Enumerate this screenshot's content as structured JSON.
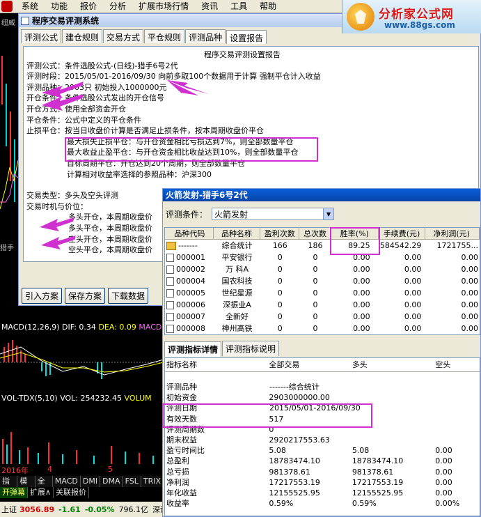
{
  "menubar": {
    "items": [
      "系统",
      "功能",
      "报价",
      "分析",
      "扩展市场行情",
      "资讯",
      "工具",
      "帮助"
    ]
  },
  "logo": {
    "brand": "分析家公式网",
    "url": "www.88gs.com"
  },
  "background": {
    "left_label": "纽威",
    "lower_label": "猎手",
    "macd": {
      "name": "MACD(12,26,9)",
      "dif": "DIF: 0.34",
      "dea": "DEA: 0.09",
      "extra": "MACD"
    },
    "vol": {
      "name": "VOL-TDX(5,10)",
      "vol": "VOL: 254232.45",
      "extra": "VOLUM"
    },
    "year": "2016年",
    "year_marks": [
      "4",
      "5"
    ],
    "tabs": [
      "指标",
      "模板",
      "全部",
      "MACD",
      "DMI",
      "DMA",
      "FSL",
      "TRIX"
    ],
    "tabs2": [
      "开弹幕",
      "扩展∧",
      "关联报价"
    ],
    "status": {
      "index": "上证",
      "value": "3056.89",
      "change": "-1.61",
      "pct": "-0.05%",
      "amount": "796.1亿",
      "more": "深证"
    }
  },
  "dialog": {
    "title": "程序交易评测系统",
    "tabs": [
      "评测公式",
      "建仓规则",
      "交易方式",
      "平仓规则",
      "评测品种",
      "设置报告"
    ],
    "active_tab": 5,
    "report": {
      "heading": "程序交易评测设置报告",
      "formula": "评测公式：条件选股公式-(日线)-猎手6号2代",
      "period": "评测时段：2015/05/01-2016/09/30  向前多取100个数据用于计算 强制平仓计入收益",
      "variety": "评测品种：2903只  初始投入1000000元",
      "open_cond": "开仓条件：条件选股公式发出的开仓信号",
      "open_method": "开仓方式：使用全部资金开仓",
      "close_cond": "平仓条件：公式中定义的平仓条件",
      "stop": "止损平仓：按当日收盘价计算是否满足止损条件，按本周期收盘价平仓",
      "max_loss": "最大损失止损平仓：与开仓资金相比亏损达到7%，则全部数量平仓",
      "max_gain": "最大收益止盈平仓：与开仓资金相比收益达到10%，则全部数量平仓",
      "target": "目标周期平仓：开仓达到20个周期，则全部数量平仓",
      "ref": "计算相对收益率选择的参照品种：沪深300",
      "trade_type": "交易类型：多头及空头评测",
      "timing": "交易时机与价位：",
      "t1": "多头开仓，本周期收盘价",
      "t2": "多头平仓，本周期收盘价",
      "t3": "空头开仓，本周期收盘价",
      "t4": "空头平仓，本周期收盘价"
    },
    "buttons": [
      "引入方案",
      "保存方案",
      "下载数据"
    ]
  },
  "result": {
    "title": "火箭发射-猎手6号2代",
    "cond_label": "评测条件：",
    "cond_value": "火箭发射",
    "columns": [
      "品种代码",
      "品种名称",
      "盈利次数",
      "总次数",
      "胜率(%)",
      "手续费(元)",
      "净利润(元)"
    ],
    "rows": [
      {
        "code": "-------",
        "name": "综合统计",
        "wins": "166",
        "total": "186",
        "rate": "89.25",
        "fee": "584542.29",
        "profit": "1721755...",
        "folder": true
      },
      {
        "code": "000001",
        "name": "平安银行",
        "wins": "0",
        "total": "0",
        "rate": "0.00",
        "fee": "0.00",
        "profit": "0.00"
      },
      {
        "code": "000002",
        "name": "万 科A",
        "wins": "0",
        "total": "0",
        "rate": "0.00",
        "fee": "0.00",
        "profit": "0.00"
      },
      {
        "code": "000004",
        "name": "国农科技",
        "wins": "0",
        "total": "0",
        "rate": "0.00",
        "fee": "0.00",
        "profit": "0.00"
      },
      {
        "code": "000005",
        "name": "世纪星源",
        "wins": "0",
        "total": "0",
        "rate": "0.00",
        "fee": "0.00",
        "profit": "0.00"
      },
      {
        "code": "000006",
        "name": "深振业A",
        "wins": "0",
        "total": "0",
        "rate": "0.00",
        "fee": "0.00",
        "profit": "0.00"
      },
      {
        "code": "000007",
        "name": "全新好",
        "wins": "0",
        "total": "0",
        "rate": "0.00",
        "fee": "0.00",
        "profit": "0.00"
      },
      {
        "code": "000008",
        "name": "神州高铁",
        "wins": "0",
        "total": "0",
        "rate": "0.00",
        "fee": "0.00",
        "profit": "0.00"
      }
    ],
    "tabs": [
      "评测指标详情",
      "评测指标说明"
    ],
    "detail_columns": [
      "指标名称",
      "全部交易",
      "多头",
      "空头"
    ],
    "detail_rows": [
      {
        "name": "评测品种",
        "all": "-------综合统计",
        "long": "",
        "short": "",
        "span": true
      },
      {
        "name": "初始资金",
        "all": "2903000000.00",
        "long": "",
        "short": ""
      },
      {
        "name": "评测日期",
        "all": "2015/05/01-2016/09/30",
        "long": "",
        "short": "",
        "span": true
      },
      {
        "name": "有效天数",
        "all": "517",
        "long": "",
        "short": ""
      },
      {
        "name": "评测周期数",
        "all": "0",
        "long": "",
        "short": ""
      },
      {
        "name": "期末权益",
        "all": "2920217553.63",
        "long": "",
        "short": ""
      },
      {
        "name": "盈亏时间比",
        "all": "5.08",
        "long": "5.08",
        "short": "0.00"
      },
      {
        "name": "总盈利",
        "all": "18783474.10",
        "long": "18783474.10",
        "short": "0.00"
      },
      {
        "name": "总亏损",
        "all": "981378.61",
        "long": "981378.61",
        "short": "0.00"
      },
      {
        "name": "净利润",
        "all": "17217553.19",
        "long": "17217553.19",
        "short": "0.00"
      },
      {
        "name": "年化收益",
        "all": "12155525.95",
        "long": "12155525.95",
        "short": "0.00"
      },
      {
        "name": "收益率",
        "all": "0.59%",
        "long": "0.59%",
        "short": "0.00%"
      }
    ]
  },
  "colors": {
    "highlight": "#d030d0",
    "title_blue": "#0844a8",
    "up": "#d00000",
    "down": "#008000"
  }
}
